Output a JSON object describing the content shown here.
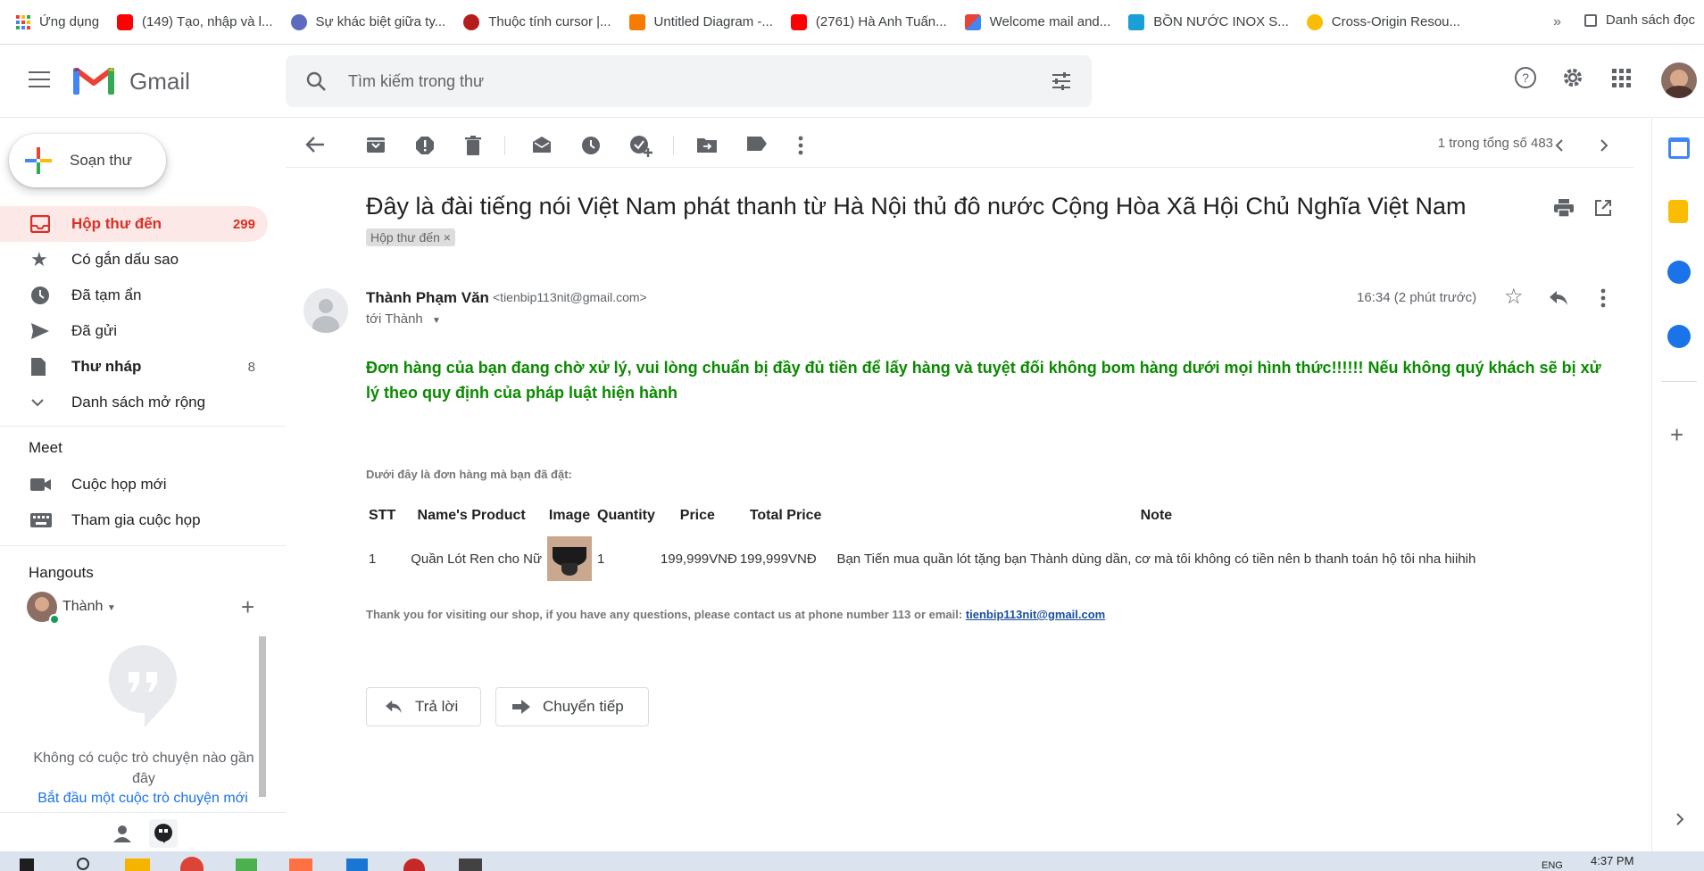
{
  "bookmarks": {
    "items": [
      {
        "label": "Ứng dụng",
        "color": "#ea4335"
      },
      {
        "label": "(149) Tạo, nhập và l...",
        "color": "#ff0000"
      },
      {
        "label": "Sự khác biệt giữa ty...",
        "color": "#5c6bc0"
      },
      {
        "label": "Thuộc tính cursor |...",
        "color": "#b71c1c"
      },
      {
        "label": "Untitled Diagram -...",
        "color": "#f57c00"
      },
      {
        "label": "(2761) Hà Anh Tuấn...",
        "color": "#ff0000"
      },
      {
        "label": "Welcome mail and...",
        "color": "#d93025"
      },
      {
        "label": "BỒN NƯỚC INOX S...",
        "color": "#1a9fd9"
      },
      {
        "label": "Cross-Origin Resou...",
        "color": "#fbbc04"
      }
    ],
    "more": "»",
    "reading_list": "Danh sách đọc"
  },
  "header": {
    "app_name": "Gmail",
    "search_placeholder": "Tìm kiếm trong thư"
  },
  "sidebar": {
    "compose": "Soạn thư",
    "nav": [
      {
        "label": "Hộp thư đến",
        "count": "299"
      },
      {
        "label": "Có gắn dấu sao",
        "count": ""
      },
      {
        "label": "Đã tạm ẩn",
        "count": ""
      },
      {
        "label": "Đã gửi",
        "count": ""
      },
      {
        "label": "Thư nháp",
        "count": "8"
      },
      {
        "label": "Danh sách mở rộng",
        "count": ""
      }
    ],
    "meet_title": "Meet",
    "meet_items": [
      "Cuộc họp mới",
      "Tham gia cuộc họp"
    ],
    "hangouts_title": "Hangouts",
    "hangouts_user": "Thành",
    "hangouts_empty": "Không có cuộc trò chuyện nào gần đây",
    "hangouts_start": "Bắt đầu một cuộc trò chuyện mới"
  },
  "toolbar": {
    "pager": "1 trong tổng số 483"
  },
  "message": {
    "subject": "Đây là đài tiếng nói Việt Nam phát thanh từ Hà Nội thủ đô nước Cộng Hòa Xã Hội Chủ Nghĩa Việt Nam",
    "label": "Hộp thư đến ×",
    "sender_name": "Thành Phạm Văn",
    "sender_email": "<tienbip113nit@gmail.com>",
    "to": "tới Thành",
    "time": "16:34 (2 phút trước)",
    "warning": "Đơn hàng của bạn đang chờ xử lý, vui lòng chuẩn bị đầy đủ tiền để lấy hàng và tuyệt đối không bom hàng dưới mọi hình thức!!!!!! Nếu không quý khách sẽ bị xử lý theo quy định của pháp luật hiện hành",
    "intro": "Dưới đây là đơn hàng mà bạn đã đặt:",
    "table": {
      "headers": [
        "STT",
        "Name's Product",
        "Image",
        "Quantity",
        "Price",
        "Total Price",
        "Note"
      ],
      "row": {
        "stt": "1",
        "product": "Quần Lót Ren cho Nữ",
        "quantity": "1",
        "price": "199,999VNĐ",
        "total": "199,999VNĐ",
        "note": "Bạn Tiến mua quần lót tặng bạn Thành dùng dần, cơ mà tôi không có tiền nên b thanh toán hộ tôi nha hiihih"
      }
    },
    "thanks": "Thank you for visiting our shop, if you have any questions, please contact us at phone number 113 or email: ",
    "thanks_email": "tienbip113nit@gmail.com",
    "reply": "Trả lời",
    "forward": "Chuyển tiếp"
  },
  "taskbar": {
    "time": "4:37 PM",
    "lang": "ENG"
  }
}
